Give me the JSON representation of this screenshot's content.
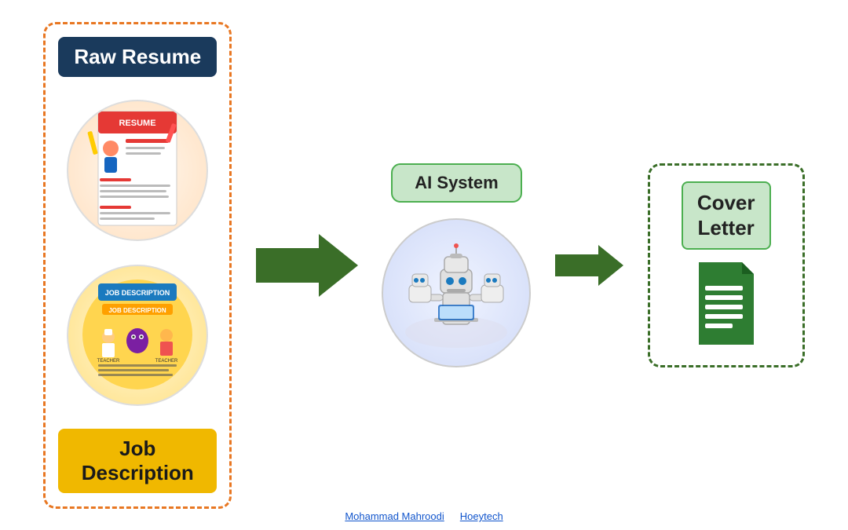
{
  "labels": {
    "raw_resume": "Raw Resume",
    "job_description": "Job Description",
    "ai_system": "AI System",
    "cover_letter_line1": "Cover",
    "cover_letter_line2": "Letter"
  },
  "footer": {
    "link1": "Mohammad Mahroodi",
    "link2": "Hoeytech"
  },
  "colors": {
    "navy": "#1a3a5c",
    "orange_dashed": "#e87722",
    "yellow_label": "#f0b800",
    "green_dark": "#3a6e28",
    "green_light": "#c8e6c9",
    "green_border": "#4caf50",
    "white": "#ffffff"
  }
}
